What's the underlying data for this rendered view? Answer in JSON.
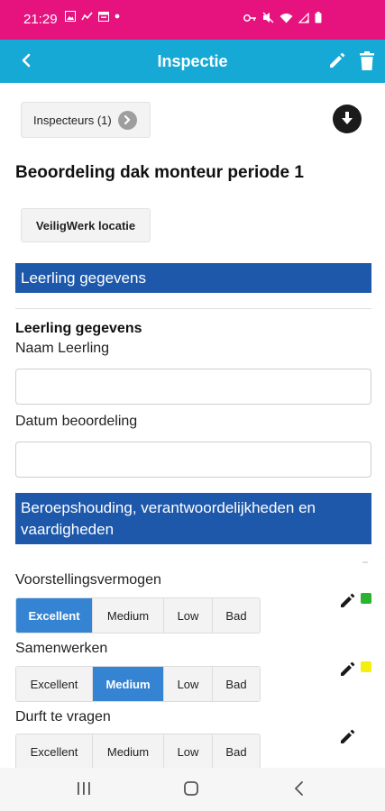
{
  "status_bar": {
    "time": "21:29",
    "background_color": "#e6127e",
    "left_icons": [
      "image-icon",
      "activity-icon",
      "calendar-icon",
      "dot-icon"
    ],
    "right_icons": [
      "key-icon",
      "mute-icon",
      "wifi-icon",
      "signal-icon",
      "battery-icon"
    ]
  },
  "app_bar": {
    "title": "Inspectie",
    "background_color": "#16a9d6",
    "back_icon": "arrow-left-icon",
    "edit_icon": "pencil-icon",
    "delete_icon": "trash-icon"
  },
  "top": {
    "inspecteurs_label": "Inspecteurs (1)",
    "inspecteurs_icon": "chevron-right-icon",
    "download_icon": "download-icon"
  },
  "form": {
    "title": "Beoordeling dak monteur periode 1",
    "location_button": "VeiligWerk locatie",
    "section1_banner": "Leerling gegevens",
    "section1_subheading": "Leerling gegevens",
    "field_name_label": "Naam Leerling",
    "field_name_value": "",
    "field_date_label": "Datum beoordeling",
    "field_date_value": "",
    "section2_banner": "Beroepshouding, verantwoordelijkheden en vaardigheden",
    "banner_color": "#1d58ab",
    "selected_color": "#3584d4"
  },
  "ratings": [
    {
      "label": "Voorstellingsvermogen",
      "options": [
        "Excellent",
        "Medium",
        "Low",
        "Bad"
      ],
      "selected": "Excellent",
      "status_color": "#2ab32e"
    },
    {
      "label": "Samenwerken",
      "options": [
        "Excellent",
        "Medium",
        "Low",
        "Bad"
      ],
      "selected": "Medium",
      "status_color": "#f4ef0f"
    },
    {
      "label": "Durft te vragen",
      "options": [
        "Excellent",
        "Medium",
        "Low",
        "Bad"
      ],
      "selected": null,
      "status_color": null
    }
  ],
  "nav_bar": {
    "icons": [
      "recent-apps-icon",
      "home-icon",
      "back-icon"
    ]
  }
}
